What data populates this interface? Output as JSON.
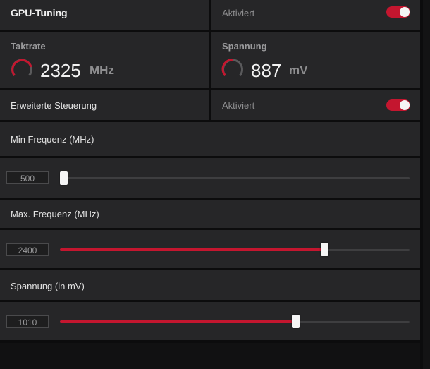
{
  "header": {
    "title": "GPU-Tuning",
    "status": "Aktiviert",
    "toggle_on": true
  },
  "metrics": {
    "clock": {
      "label": "Taktrate",
      "value": "2325",
      "unit": "MHz"
    },
    "voltage": {
      "label": "Spannung",
      "value": "887",
      "unit": "mV"
    }
  },
  "advanced": {
    "label": "Erweiterte Steuerung",
    "status": "Aktiviert",
    "toggle_on": true
  },
  "sliders": [
    {
      "label": "Min Frequenz (MHz)",
      "value": "500",
      "level": 0.0
    },
    {
      "label": "Max. Frequenz (MHz)",
      "value": "2400",
      "level": 0.757
    },
    {
      "label": "Spannung (in mV)",
      "value": "1010",
      "level": 0.674
    }
  ],
  "colors": {
    "accent": "#c4162f",
    "panel": "#262628",
    "background": "#0c0c0d"
  }
}
